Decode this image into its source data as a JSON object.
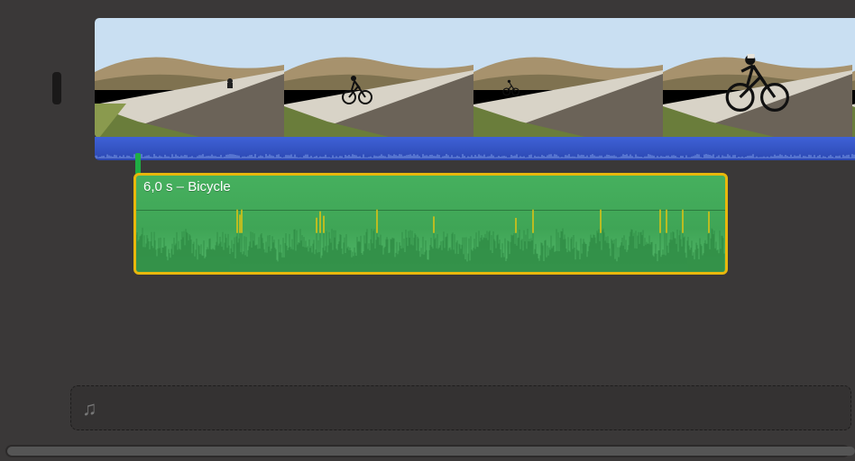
{
  "colors": {
    "accent_video": "#3155d0",
    "accent_audio": "#46b05e",
    "selection": "#e8b70c"
  },
  "audio_clip": {
    "label": "6,0 s – Bicycle",
    "selected": true
  },
  "music_well": {
    "icon_glyph": "♫"
  }
}
